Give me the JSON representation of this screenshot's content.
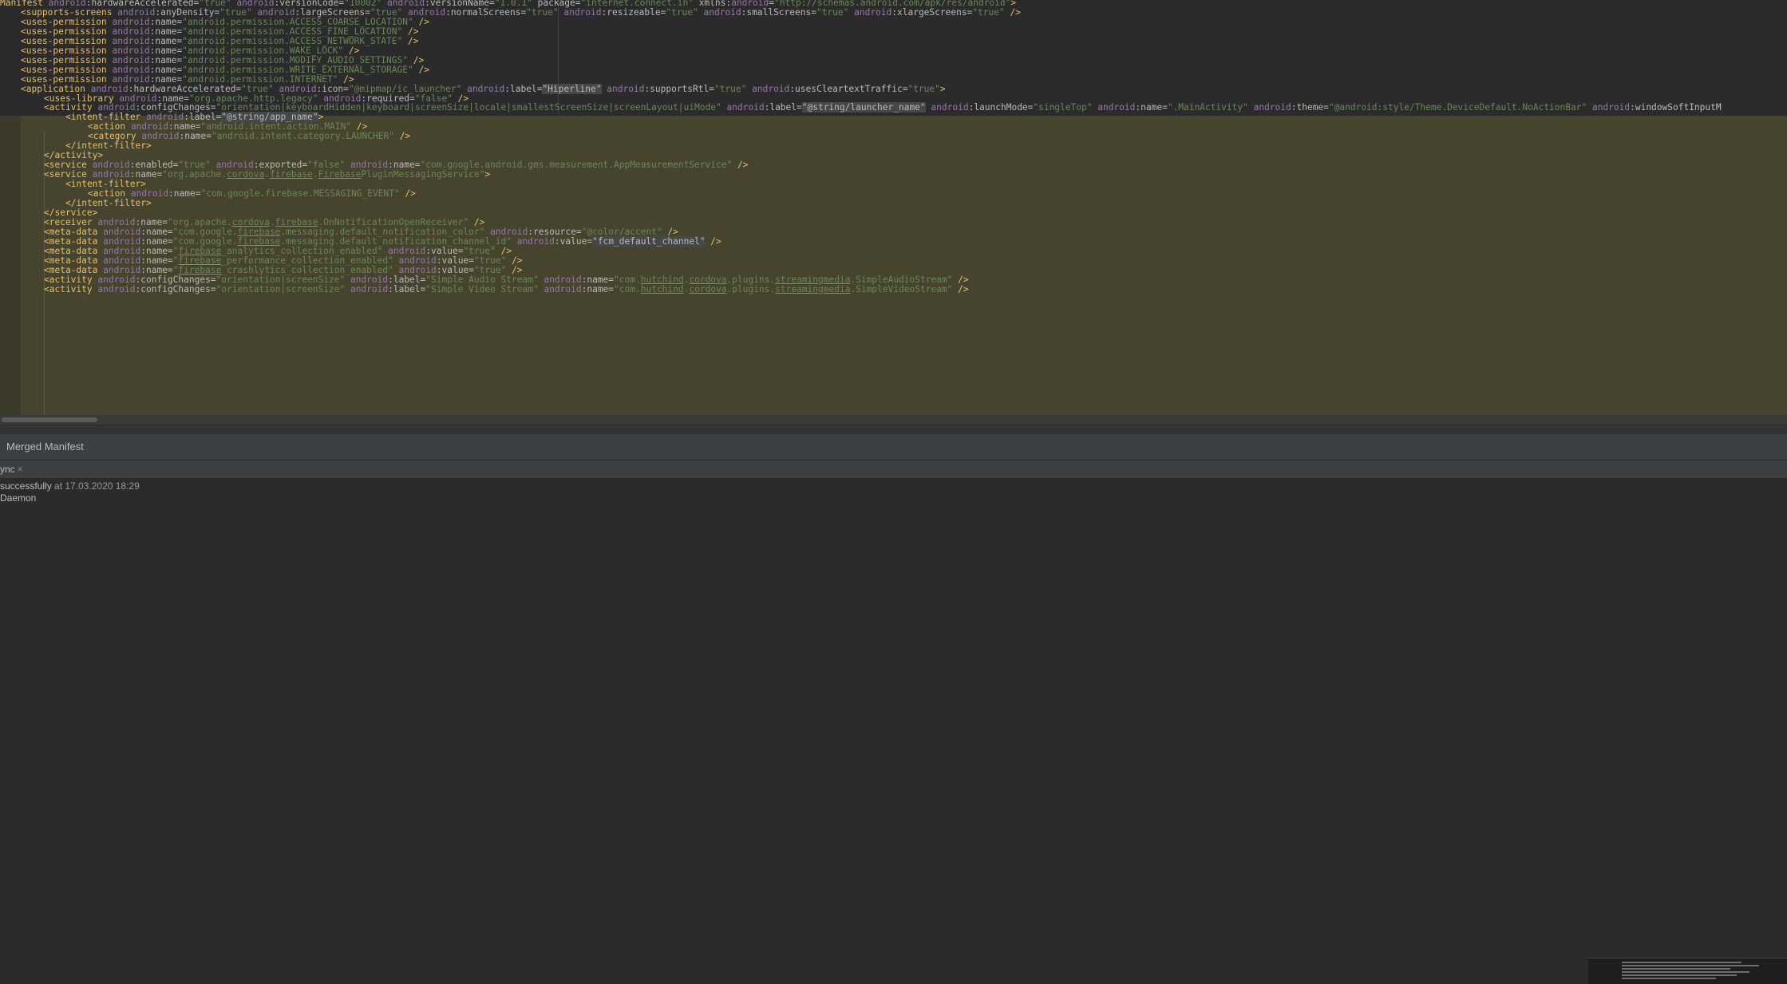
{
  "editor": {
    "lines": [
      [
        [
          "tg",
          "Manifest "
        ],
        [
          "ns",
          "android"
        ],
        [
          "at",
          ":hardwareAccelerated="
        ],
        [
          "vl",
          "\"true\" "
        ],
        [
          "ns",
          "android"
        ],
        [
          "at",
          ":versionCode="
        ],
        [
          "vl",
          "\"10002\" "
        ],
        [
          "ns",
          "android"
        ],
        [
          "at",
          ":versionName="
        ],
        [
          "vl",
          "\"1.0.1\" "
        ],
        [
          "at",
          "package="
        ],
        [
          "vl",
          "\"internet.connect.in\" "
        ],
        [
          "at",
          "xmlns:"
        ],
        [
          "ns",
          "android"
        ],
        [
          "at",
          "="
        ],
        [
          "vl",
          "\"http://schemas.android.com/apk/res/android\""
        ],
        [
          "tg",
          "&gt;"
        ]
      ],
      [
        [
          "tg",
          "<supports-screens "
        ],
        [
          "ns",
          "android"
        ],
        [
          "at",
          ":anyDensity="
        ],
        [
          "vl",
          "\"true\" "
        ],
        [
          "ns",
          "android"
        ],
        [
          "at",
          ":largeScreens="
        ],
        [
          "vl",
          "\"true\" "
        ],
        [
          "ns",
          "android"
        ],
        [
          "at",
          ":normalScreens="
        ],
        [
          "vl",
          "\"true\" "
        ],
        [
          "ns",
          "android"
        ],
        [
          "at",
          ":resizeable="
        ],
        [
          "vl",
          "\"true\" "
        ],
        [
          "ns",
          "android"
        ],
        [
          "at",
          ":smallScreens="
        ],
        [
          "vl",
          "\"true\" "
        ],
        [
          "ns",
          "android"
        ],
        [
          "at",
          ":xlargeScreens="
        ],
        [
          "vl",
          "\"true\" "
        ],
        [
          "tg",
          "/>"
        ]
      ],
      [
        [
          "tg",
          "<uses-permission "
        ],
        [
          "ns",
          "android"
        ],
        [
          "at",
          ":name="
        ],
        [
          "vl",
          "\"android.permission.ACCESS_COARSE_LOCATION\" "
        ],
        [
          "tg",
          "/>"
        ]
      ],
      [
        [
          "tg",
          "<uses-permission "
        ],
        [
          "ns",
          "android"
        ],
        [
          "at",
          ":name="
        ],
        [
          "vl",
          "\"android.permission.ACCESS_FINE_LOCATION\" "
        ],
        [
          "tg",
          "/>"
        ]
      ],
      [
        [
          "tg",
          "<uses-permission "
        ],
        [
          "ns",
          "android"
        ],
        [
          "at",
          ":name="
        ],
        [
          "vl",
          "\"android.permission.ACCESS_NETWORK_STATE\" "
        ],
        [
          "tg",
          "/>"
        ]
      ],
      [
        [
          "tg",
          "<uses-permission "
        ],
        [
          "ns",
          "android"
        ],
        [
          "at",
          ":name="
        ],
        [
          "vl",
          "\"android.permission.WAKE_LOCK\" "
        ],
        [
          "tg",
          "/>"
        ]
      ],
      [
        [
          "tg",
          "<uses-permission "
        ],
        [
          "ns",
          "android"
        ],
        [
          "at",
          ":name="
        ],
        [
          "vl",
          "\"android.permission.MODIFY_AUDIO_SETTINGS\" "
        ],
        [
          "tg",
          "/>"
        ]
      ],
      [
        [
          "tg",
          "<uses-permission "
        ],
        [
          "ns",
          "android"
        ],
        [
          "at",
          ":name="
        ],
        [
          "vl",
          "\"android.permission.WRITE_EXTERNAL_STORAGE\" "
        ],
        [
          "tg",
          "/>"
        ]
      ],
      [
        [
          "tg",
          "<uses-permission "
        ],
        [
          "ns",
          "android"
        ],
        [
          "at",
          ":name="
        ],
        [
          "vl",
          "\"android.permission.INTERNET\" "
        ],
        [
          "tg",
          "/>"
        ]
      ],
      [
        [
          "tg",
          "<application "
        ],
        [
          "ns",
          "android"
        ],
        [
          "at",
          ":hardwareAccelerated="
        ],
        [
          "vl",
          "\"true\" "
        ],
        [
          "ns",
          "android"
        ],
        [
          "at",
          ":icon="
        ],
        [
          "vl",
          "\"@mipmap/ic_launcher\" "
        ],
        [
          "ns",
          "android"
        ],
        [
          "at",
          ":label="
        ],
        [
          "sel",
          "\"Hiperline\""
        ],
        [
          "at",
          " "
        ],
        [
          "ns",
          "android"
        ],
        [
          "at",
          ":supportsRtl="
        ],
        [
          "vl",
          "\"true\" "
        ],
        [
          "ns",
          "android"
        ],
        [
          "at",
          ":usesCleartextTraffic="
        ],
        [
          "vl",
          "\"true\""
        ],
        [
          "tg",
          ">"
        ]
      ],
      [
        [
          "tg",
          "<uses-library "
        ],
        [
          "ns",
          "android"
        ],
        [
          "at",
          ":name="
        ],
        [
          "vl",
          "\"org.apache.http.legacy\" "
        ],
        [
          "ns",
          "android"
        ],
        [
          "at",
          ":required="
        ],
        [
          "vl",
          "\"false\" "
        ],
        [
          "tg",
          "/>"
        ]
      ],
      [
        [
          "tg",
          "<activity "
        ],
        [
          "ns",
          "android"
        ],
        [
          "at",
          ":configChanges="
        ],
        [
          "vl",
          "\"orientation|keyboardHidden|keyboard|screenSize|locale|smallestScreenSize|screenLayout|uiMode\" "
        ],
        [
          "ns",
          "android"
        ],
        [
          "at",
          ":label="
        ],
        [
          "sel",
          "\"@string/launcher_name\""
        ],
        [
          "at",
          " "
        ],
        [
          "ns",
          "android"
        ],
        [
          "at",
          ":launchMode="
        ],
        [
          "vl",
          "\"singleTop\" "
        ],
        [
          "ns",
          "android"
        ],
        [
          "at",
          ":name="
        ],
        [
          "vl",
          "\".MainActivity\" "
        ],
        [
          "ns",
          "android"
        ],
        [
          "at",
          ":theme="
        ],
        [
          "vl",
          "\"@android:style/Theme.DeviceDefault.NoActionBar\" "
        ],
        [
          "ns",
          "android"
        ],
        [
          "at",
          ":windowSoftInputM"
        ]
      ],
      [
        [
          "tg",
          "<intent-filter "
        ],
        [
          "ns",
          "android"
        ],
        [
          "at",
          ":label="
        ],
        [
          "sel",
          "\"@string/app_name\""
        ],
        [
          "tg",
          ">"
        ]
      ],
      [
        [
          "tg",
          "<action "
        ],
        [
          "ns",
          "android"
        ],
        [
          "at",
          ":name="
        ],
        [
          "vl",
          "\"android.intent.action.MAIN\" "
        ],
        [
          "tg",
          "/>"
        ]
      ],
      [
        [
          "tg",
          "<category "
        ],
        [
          "ns",
          "android"
        ],
        [
          "at",
          ":name="
        ],
        [
          "vl",
          "\"android.intent.category.LAUNCHER\" "
        ],
        [
          "tg",
          "/>"
        ]
      ],
      [
        [
          "tg",
          "</intent-filter>"
        ]
      ],
      [
        [
          "tg",
          "</activity>"
        ]
      ],
      [
        [
          "tg",
          "<service "
        ],
        [
          "ns",
          "android"
        ],
        [
          "at",
          ":enabled="
        ],
        [
          "vl",
          "\"true\" "
        ],
        [
          "ns",
          "android"
        ],
        [
          "at",
          ":exported="
        ],
        [
          "vl",
          "\"false\" "
        ],
        [
          "ns",
          "android"
        ],
        [
          "at",
          ":name="
        ],
        [
          "vl",
          "\"com.google.android.gms.measurement.AppMeasurementService\" "
        ],
        [
          "tg",
          "/>"
        ]
      ],
      [
        [
          "tg",
          "<service "
        ],
        [
          "ns",
          "android"
        ],
        [
          "at",
          ":name="
        ],
        [
          "vl",
          "\"org.apache."
        ],
        [
          "vlu",
          "cordova"
        ],
        [
          "vl",
          "."
        ],
        [
          "vlu",
          "firebase"
        ],
        [
          "vl",
          "."
        ],
        [
          "vlu",
          "Firebase"
        ],
        [
          "vl",
          "PluginMessagingService\""
        ],
        [
          "tg",
          ">"
        ]
      ],
      [
        [
          "tg",
          "<intent-filter>"
        ]
      ],
      [
        [
          "tg",
          "<action "
        ],
        [
          "ns",
          "android"
        ],
        [
          "at",
          ":name="
        ],
        [
          "vl",
          "\"com.google.firebase.MESSAGING_EVENT\" "
        ],
        [
          "tg",
          "/>"
        ]
      ],
      [
        [
          "tg",
          "</intent-filter>"
        ]
      ],
      [
        [
          "tg",
          "</service>"
        ]
      ],
      [
        [
          "tg",
          "<receiver "
        ],
        [
          "ns",
          "android"
        ],
        [
          "at",
          ":name="
        ],
        [
          "vl",
          "\"org.apache."
        ],
        [
          "vlu",
          "cordova"
        ],
        [
          "vl",
          "."
        ],
        [
          "vlu",
          "firebase"
        ],
        [
          "vl",
          ".OnNotificationOpenReceiver\" "
        ],
        [
          "tg",
          "/>"
        ]
      ],
      [
        [
          "tg",
          "<meta-data "
        ],
        [
          "ns",
          "android"
        ],
        [
          "at",
          ":name="
        ],
        [
          "vl",
          "\"com.google."
        ],
        [
          "vlu",
          "firebase"
        ],
        [
          "vl",
          ".messaging.default_notification_color\" "
        ],
        [
          "ns",
          "android"
        ],
        [
          "at",
          ":resource="
        ],
        [
          "vl",
          "\"@color/accent\" "
        ],
        [
          "tg",
          "/>"
        ]
      ],
      [
        [
          "tg",
          "<meta-data "
        ],
        [
          "ns",
          "android"
        ],
        [
          "at",
          ":name="
        ],
        [
          "vl",
          "\"com.google."
        ],
        [
          "vlu",
          "firebase"
        ],
        [
          "vl",
          ".messaging.default_notification_channel_id\" "
        ],
        [
          "ns",
          "android"
        ],
        [
          "at",
          ":value="
        ],
        [
          "sel",
          "\"fcm_default_channel\""
        ],
        [
          "at",
          " "
        ],
        [
          "tg",
          "/>"
        ]
      ],
      [
        [
          "tg",
          "<meta-data "
        ],
        [
          "ns",
          "android"
        ],
        [
          "at",
          ":name="
        ],
        [
          "vl",
          "\""
        ],
        [
          "vlu",
          "firebase"
        ],
        [
          "vl",
          "_analytics_collection_enabled\" "
        ],
        [
          "ns",
          "android"
        ],
        [
          "at",
          ":value="
        ],
        [
          "vl",
          "\"true\" "
        ],
        [
          "tg",
          "/>"
        ]
      ],
      [
        [
          "tg",
          "<meta-data "
        ],
        [
          "ns",
          "android"
        ],
        [
          "at",
          ":name="
        ],
        [
          "vl",
          "\""
        ],
        [
          "vlu",
          "firebase"
        ],
        [
          "vl",
          "_performance_collection_enabled\" "
        ],
        [
          "ns",
          "android"
        ],
        [
          "at",
          ":value="
        ],
        [
          "vl",
          "\"true\" "
        ],
        [
          "tg",
          "/>"
        ]
      ],
      [
        [
          "tg",
          "<meta-data "
        ],
        [
          "ns",
          "android"
        ],
        [
          "at",
          ":name="
        ],
        [
          "vl",
          "\""
        ],
        [
          "vlu",
          "firebase"
        ],
        [
          "vl",
          "_crashlytics_collection_enabled\" "
        ],
        [
          "ns",
          "android"
        ],
        [
          "at",
          ":value="
        ],
        [
          "vl",
          "\"true\" "
        ],
        [
          "tg",
          "/>"
        ]
      ],
      [
        [
          "tg",
          "<activity "
        ],
        [
          "ns",
          "android"
        ],
        [
          "at",
          ":configChanges="
        ],
        [
          "vl",
          "\"orientation|screenSize\" "
        ],
        [
          "ns",
          "android"
        ],
        [
          "at",
          ":label="
        ],
        [
          "vl",
          "\"Simple Audio Stream\" "
        ],
        [
          "ns",
          "android"
        ],
        [
          "at",
          ":name="
        ],
        [
          "vl",
          "\"com."
        ],
        [
          "vlu",
          "hutchind"
        ],
        [
          "vl",
          "."
        ],
        [
          "vlu",
          "cordova"
        ],
        [
          "vl",
          ".plugins."
        ],
        [
          "vlu",
          "streamingmedia"
        ],
        [
          "vl",
          ".SimpleAudioStream\" "
        ],
        [
          "tg",
          "/>"
        ]
      ],
      [
        [
          "tg",
          "<activity "
        ],
        [
          "ns",
          "android"
        ],
        [
          "at",
          ":configChanges="
        ],
        [
          "vl",
          "\"orientation|screenSize\" "
        ],
        [
          "ns",
          "android"
        ],
        [
          "at",
          ":label="
        ],
        [
          "vl",
          "\"Simple Video Stream\" "
        ],
        [
          "ns",
          "android"
        ],
        [
          "at",
          ":name="
        ],
        [
          "vl",
          "\"com."
        ],
        [
          "vlu",
          "hutchind"
        ],
        [
          "vl",
          "."
        ],
        [
          "vlu",
          "cordova"
        ],
        [
          "vl",
          ".plugins."
        ],
        [
          "vlu",
          "streamingmedia"
        ],
        [
          "vl",
          ".SimpleVideoStream\" "
        ],
        [
          "tg",
          "/>"
        ]
      ]
    ]
  },
  "tabs": {
    "merged_manifest": "Merged Manifest"
  },
  "sync": {
    "label": "ync",
    "close_glyph": "✕"
  },
  "build": {
    "status_prefix": "successfully",
    "status_at": " at 17.03.2020 18:29",
    "daemon": "Daemon"
  },
  "colors": {
    "tag": "#e8bf6a",
    "namespace": "#9876aa",
    "attribute": "#bababa",
    "value": "#6a8759",
    "highlight_block": "#46442e"
  }
}
